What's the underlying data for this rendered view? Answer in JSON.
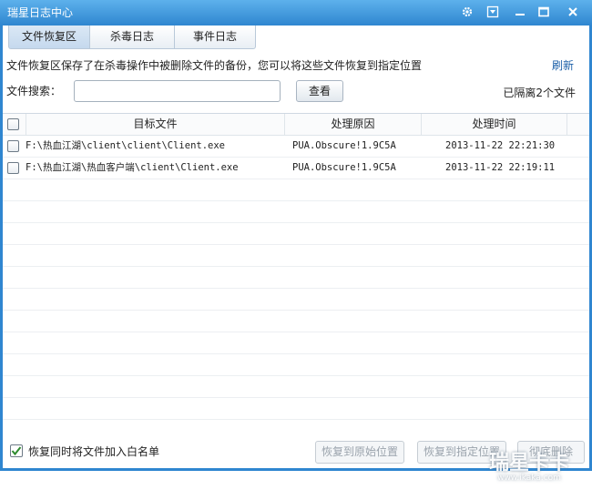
{
  "window": {
    "title": "瑞星日志中心"
  },
  "tabs": [
    {
      "label": "文件恢复区",
      "active": true
    },
    {
      "label": "杀毒日志",
      "active": false
    },
    {
      "label": "事件日志",
      "active": false
    }
  ],
  "info": {
    "description": "文件恢复区保存了在杀毒操作中被删除文件的备份，您可以将这些文件恢复到指定位置",
    "refresh_label": "刷新",
    "isolated_count_text": "已隔离2个文件"
  },
  "search": {
    "label": "文件搜索：",
    "value": "",
    "button_label": "查看"
  },
  "table": {
    "columns": [
      "目标文件",
      "处理原因",
      "处理时间"
    ],
    "rows": [
      {
        "file": "F:\\热血江湖\\client\\client\\Client.exe",
        "reason": "PUA.Obscure!1.9C5A",
        "time": "2013-11-22 22:21:30"
      },
      {
        "file": "F:\\热血江湖\\热血客户端\\client\\Client.exe",
        "reason": "PUA.Obscure!1.9C5A",
        "time": "2013-11-22 22:19:11"
      }
    ]
  },
  "footer": {
    "whitelist_label": "恢复同时将文件加入白名单",
    "whitelist_checked": true,
    "restore_original_label": "恢复到原始位置",
    "restore_specified_label": "恢复到指定位置",
    "delete_label": "彻底删除"
  },
  "watermark": {
    "brand": "瑞星卡卡",
    "url": "www.ikaka.com"
  },
  "colors": {
    "titlebar": "#2f86d0",
    "link": "#1b5fa8"
  }
}
